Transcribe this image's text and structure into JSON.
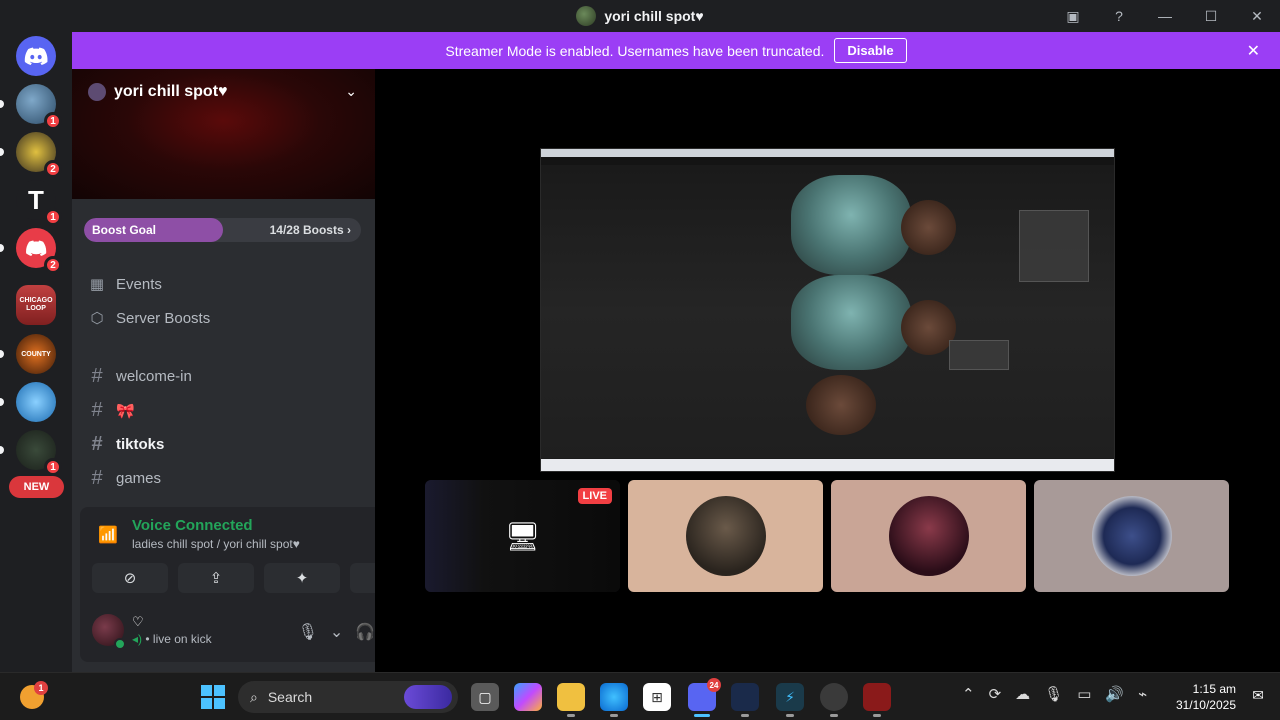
{
  "window": {
    "title": "yori chill spot♥"
  },
  "banner": {
    "text": "Streamer Mode is enabled. Usernames have been truncated.",
    "button": "Disable"
  },
  "guilds": [
    {
      "name": "guild-1",
      "badge": "1"
    },
    {
      "name": "guild-2",
      "badge": "2"
    },
    {
      "name": "guild-3",
      "badge": "1",
      "label": "T"
    },
    {
      "name": "guild-4",
      "badge": "2"
    },
    {
      "name": "guild-chicago",
      "label": "CHICAGO LOOP",
      "badge": ""
    },
    {
      "name": "guild-county",
      "label": "COUNTY",
      "badge": ""
    },
    {
      "name": "guild-6",
      "badge": ""
    },
    {
      "name": "guild-7",
      "badge": "1"
    }
  ],
  "new_badge": "NEW",
  "server": {
    "name": "yori chill spot♥",
    "boost_goal": {
      "label": "Boost Goal",
      "count": "14/28 Boosts",
      "progress": 0.5
    },
    "nav": [
      {
        "label": "Events"
      },
      {
        "label": "Server Boosts"
      }
    ],
    "channels": [
      {
        "name": "welcome-in",
        "bold": false
      },
      {
        "name": "🎀",
        "bold": false
      },
      {
        "name": "tiktoks",
        "bold": true
      },
      {
        "name": "games",
        "bold": false
      }
    ]
  },
  "voice": {
    "status": "Voice Connected",
    "location": "ladies chill spot / yori chill spot♥"
  },
  "user": {
    "name": "♡",
    "status": "live on kick"
  },
  "stage": {
    "live_badge": "LIVE"
  },
  "taskbar": {
    "search_placeholder": "Search",
    "weather_badge": "1",
    "discord_badge": "24",
    "time": "1:15 am",
    "date": "31/10/2025"
  },
  "colors": {
    "banner": "#9b3ef5",
    "voice_connected": "#23a55a",
    "badge_red": "#f23f43",
    "boost_fill": "#8e4fa6"
  }
}
